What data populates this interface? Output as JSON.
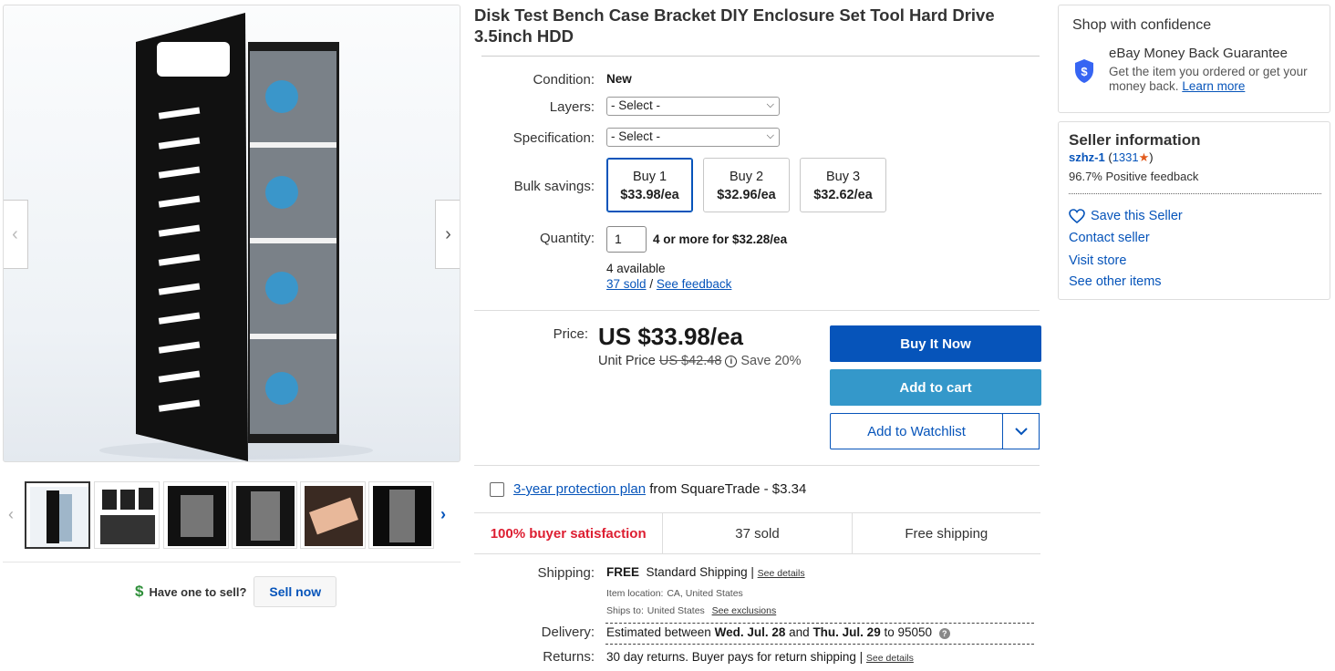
{
  "gallery": {
    "prev_arrow": "‹",
    "next_arrow": "›",
    "thumb_prev": "‹",
    "thumb_next": "›",
    "thumbnail_count": 6
  },
  "sell": {
    "icon": "$",
    "question": "Have one to sell?",
    "button": "Sell now"
  },
  "item": {
    "title": "Disk Test Bench Case Bracket DIY Enclosure Set Tool Hard Drive 3.5inch HDD",
    "condition_label": "Condition:",
    "condition_value": "New",
    "layers_label": "Layers:",
    "layers_value": "- Select -",
    "spec_label": "Specification:",
    "spec_value": "- Select -",
    "bulk_label": "Bulk savings:",
    "bulk_options": [
      {
        "qty": "Buy 1",
        "price": "$33.98/ea"
      },
      {
        "qty": "Buy 2",
        "price": "$32.96/ea"
      },
      {
        "qty": "Buy 3",
        "price": "$32.62/ea"
      }
    ],
    "quantity_label": "Quantity:",
    "quantity_value": "1",
    "quantity_deal": "4 or more for $32.28/ea",
    "available": "4 available",
    "sold_link": "37 sold",
    "sold_sep": "/",
    "feedback_link": "See feedback"
  },
  "pricing": {
    "price_label": "Price:",
    "price": "US $33.98/ea",
    "unit_price_label": "Unit Price",
    "original_price": "US $42.48",
    "info_glyph": "i",
    "save": "Save 20%"
  },
  "actions": {
    "buy_now": "Buy It Now",
    "add_to_cart": "Add to cart",
    "add_to_watchlist": "Add to Watchlist",
    "chevron": "⌄"
  },
  "protection": {
    "link": "3-year protection plan",
    "text": " from SquareTrade - $3.34"
  },
  "stats": {
    "satisfaction": "100% buyer satisfaction",
    "sold": "37 sold",
    "shipping": "Free shipping"
  },
  "shipping": {
    "label": "Shipping:",
    "free": "FREE",
    "method": "Standard Shipping |",
    "details_link": "See details",
    "location_label": "Item location:",
    "location": "CA, United States",
    "ships_to_label": "Ships to:",
    "ships_to": "United States",
    "exclusions_link": "See exclusions"
  },
  "delivery": {
    "label": "Delivery:",
    "prefix": "Estimated between",
    "start": "Wed. Jul. 28",
    "and": "and",
    "end": "Thu. Jul. 29",
    "to": "to 95050",
    "help_glyph": "?"
  },
  "returns": {
    "label": "Returns:",
    "text": "30 day returns. Buyer pays for return shipping |",
    "details_link": "See details"
  },
  "confidence": {
    "title": "Shop with confidence",
    "heading": "eBay Money Back Guarantee",
    "text": "Get the item you ordered or get your money back.",
    "learn_more": "Learn more",
    "shield_symbol": "$"
  },
  "seller": {
    "title": "Seller information",
    "name": "szhz-1",
    "open_paren": "(",
    "score": "1331",
    "star": "★",
    "close_paren": ")",
    "feedback": "96.7% Positive feedback",
    "save_seller": "Save this Seller",
    "contact": "Contact seller",
    "visit_store": "Visit store",
    "other_items": "See other items"
  },
  "colors": {
    "link_blue": "#0654ba",
    "cart_blue": "#3498ca",
    "satisfaction_red": "#dd1e31",
    "star_orange": "#e25a1c"
  }
}
